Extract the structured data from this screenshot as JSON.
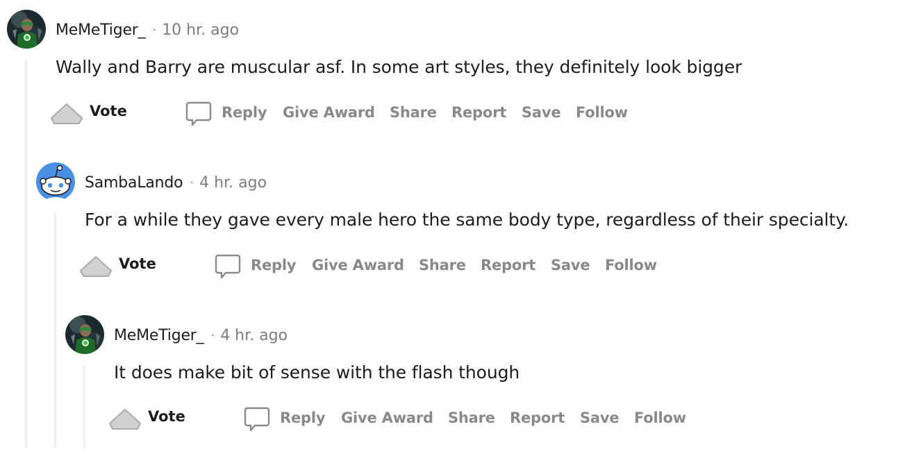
{
  "comments": [
    {
      "username": "MeMeTiger_",
      "separator": "·",
      "time": "10 hr. ago",
      "body": "Wally and Barry are muscular asf. In some art styles, they definitely look bigger",
      "avatar": "green-lantern-avatar"
    },
    {
      "username": "SambaLando",
      "separator": "·",
      "time": "4 hr. ago",
      "body": "For a while they gave every male hero the same body type, regardless of their specialty.",
      "avatar": "snoo-avatar"
    },
    {
      "username": "MeMeTiger_",
      "separator": "·",
      "time": "4 hr. ago",
      "body": "It does make bit of sense with the flash though",
      "avatar": "green-lantern-avatar"
    }
  ],
  "actions": {
    "vote": "Vote",
    "reply": "Reply",
    "give_award": "Give Award",
    "share": "Share",
    "report": "Report",
    "save": "Save",
    "follow": "Follow"
  },
  "colors": {
    "text": "#1c1c1c",
    "muted": "#7c7c7c",
    "action": "#878a8c",
    "rail": "#edeff1",
    "snoo_bg": "#4a90e2"
  }
}
